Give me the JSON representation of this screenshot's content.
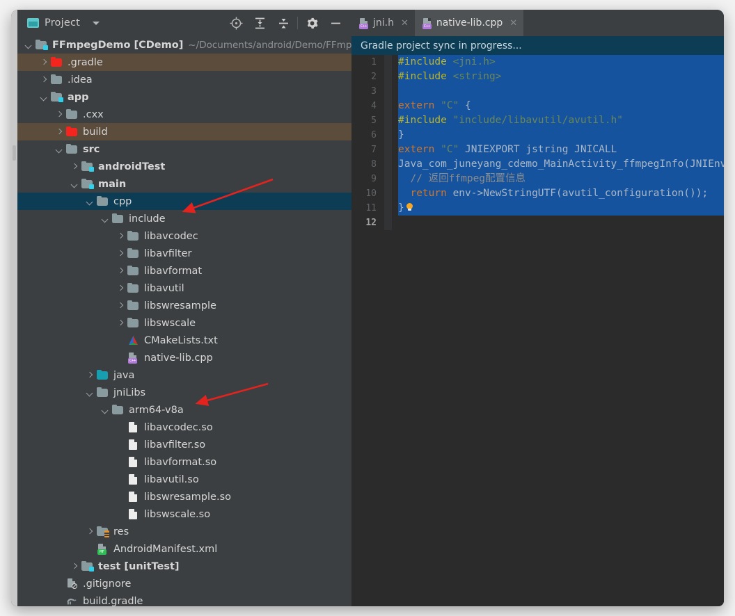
{
  "window": {
    "tool_window": {
      "title": "Project",
      "title_icon": "project-window-icon",
      "dropdown_icon": "chevron-down-icon",
      "toolbar_buttons": [
        {
          "name": "locate-icon",
          "label": "Select Opened File"
        },
        {
          "name": "expand-all-icon",
          "label": "Expand All"
        },
        {
          "name": "collapse-all-icon",
          "label": "Collapse All"
        },
        {
          "name": "gear-icon",
          "label": "Settings"
        },
        {
          "name": "minimize-icon",
          "label": "Hide"
        }
      ]
    }
  },
  "tree": [
    {
      "indent": 0,
      "arrow": "down",
      "icon": "module-folder",
      "label": "FFmpegDemo [CDemo]",
      "bold": true,
      "path": "~/Documents/android/Demo/FFmpeg",
      "highlight": "none"
    },
    {
      "indent": 1,
      "arrow": "right",
      "icon": "folder-red",
      "label": ".gradle",
      "bold": false,
      "highlight": "brown"
    },
    {
      "indent": 1,
      "arrow": "right",
      "icon": "folder",
      "label": ".idea",
      "bold": false,
      "highlight": "none"
    },
    {
      "indent": 1,
      "arrow": "down",
      "icon": "module-folder",
      "label": "app",
      "bold": true,
      "highlight": "none"
    },
    {
      "indent": 2,
      "arrow": "right",
      "icon": "folder",
      "label": ".cxx",
      "bold": false,
      "highlight": "none"
    },
    {
      "indent": 2,
      "arrow": "right",
      "icon": "folder-red",
      "label": "build",
      "bold": false,
      "highlight": "brown"
    },
    {
      "indent": 2,
      "arrow": "down",
      "icon": "folder",
      "label": "src",
      "bold": true,
      "highlight": "none"
    },
    {
      "indent": 3,
      "arrow": "right",
      "icon": "module-folder",
      "label": "androidTest",
      "bold": true,
      "highlight": "none"
    },
    {
      "indent": 3,
      "arrow": "down",
      "icon": "module-folder",
      "label": "main",
      "bold": true,
      "highlight": "none"
    },
    {
      "indent": 4,
      "arrow": "down",
      "icon": "folder",
      "label": "cpp",
      "bold": false,
      "highlight": "selected"
    },
    {
      "indent": 5,
      "arrow": "down",
      "icon": "folder",
      "label": "include",
      "bold": false,
      "highlight": "none"
    },
    {
      "indent": 6,
      "arrow": "right",
      "icon": "folder",
      "label": "libavcodec",
      "bold": false,
      "highlight": "none"
    },
    {
      "indent": 6,
      "arrow": "right",
      "icon": "folder",
      "label": "libavfilter",
      "bold": false,
      "highlight": "none"
    },
    {
      "indent": 6,
      "arrow": "right",
      "icon": "folder",
      "label": "libavformat",
      "bold": false,
      "highlight": "none"
    },
    {
      "indent": 6,
      "arrow": "right",
      "icon": "folder",
      "label": "libavutil",
      "bold": false,
      "highlight": "none"
    },
    {
      "indent": 6,
      "arrow": "right",
      "icon": "folder",
      "label": "libswresample",
      "bold": false,
      "highlight": "none"
    },
    {
      "indent": 6,
      "arrow": "right",
      "icon": "folder",
      "label": "libswscale",
      "bold": false,
      "highlight": "none"
    },
    {
      "indent": 6,
      "arrow": "none",
      "icon": "cmake-file",
      "label": "CMakeLists.txt",
      "bold": false,
      "highlight": "none"
    },
    {
      "indent": 6,
      "arrow": "none",
      "icon": "cpp-file",
      "label": "native-lib.cpp",
      "bold": false,
      "highlight": "none"
    },
    {
      "indent": 4,
      "arrow": "right",
      "icon": "folder-teal",
      "label": "java",
      "bold": false,
      "highlight": "none"
    },
    {
      "indent": 4,
      "arrow": "down",
      "icon": "folder",
      "label": "jniLibs",
      "bold": false,
      "highlight": "none"
    },
    {
      "indent": 5,
      "arrow": "down",
      "icon": "folder",
      "label": "arm64-v8a",
      "bold": false,
      "highlight": "none"
    },
    {
      "indent": 6,
      "arrow": "none",
      "icon": "file",
      "label": "libavcodec.so",
      "bold": false,
      "highlight": "none"
    },
    {
      "indent": 6,
      "arrow": "none",
      "icon": "file",
      "label": "libavfilter.so",
      "bold": false,
      "highlight": "none"
    },
    {
      "indent": 6,
      "arrow": "none",
      "icon": "file",
      "label": "libavformat.so",
      "bold": false,
      "highlight": "none"
    },
    {
      "indent": 6,
      "arrow": "none",
      "icon": "file",
      "label": "libavutil.so",
      "bold": false,
      "highlight": "none"
    },
    {
      "indent": 6,
      "arrow": "none",
      "icon": "file",
      "label": "libswresample.so",
      "bold": false,
      "highlight": "none"
    },
    {
      "indent": 6,
      "arrow": "none",
      "icon": "file",
      "label": "libswscale.so",
      "bold": false,
      "highlight": "none"
    },
    {
      "indent": 4,
      "arrow": "right",
      "icon": "res-folder",
      "label": "res",
      "bold": false,
      "highlight": "none"
    },
    {
      "indent": 4,
      "arrow": "none",
      "icon": "manifest-file",
      "label": "AndroidManifest.xml",
      "bold": false,
      "highlight": "none"
    },
    {
      "indent": 3,
      "arrow": "right",
      "icon": "module-folder",
      "label": "test [unitTest]",
      "bold": true,
      "highlight": "none"
    },
    {
      "indent": 2,
      "arrow": "none",
      "icon": "gitignore-file",
      "label": ".gitignore",
      "bold": false,
      "highlight": "none"
    },
    {
      "indent": 2,
      "arrow": "none",
      "icon": "gradle-file",
      "label": "build.gradle",
      "bold": false,
      "highlight": "none"
    }
  ],
  "editor": {
    "tabs": [
      {
        "label": "jni.h",
        "icon": "cpp-file-icon",
        "active": false,
        "close_icon": "close-icon"
      },
      {
        "label": "native-lib.cpp",
        "icon": "cpp-file-icon",
        "active": true,
        "close_icon": "close-icon"
      }
    ],
    "notification": "Gradle project sync in progress...",
    "lines": [
      {
        "n": "1",
        "selected": true,
        "tokens": [
          {
            "t": "#include ",
            "c": "pp"
          },
          {
            "t": "<jni.h>",
            "c": "s"
          }
        ]
      },
      {
        "n": "2",
        "selected": true,
        "tokens": [
          {
            "t": "#include ",
            "c": "pp"
          },
          {
            "t": "<string>",
            "c": "s"
          }
        ]
      },
      {
        "n": "3",
        "selected": true,
        "tokens": []
      },
      {
        "n": "4",
        "selected": true,
        "tokens": [
          {
            "t": "extern ",
            "c": "k"
          },
          {
            "t": "\"C\"",
            "c": "s"
          },
          {
            "t": " {",
            "c": "t"
          }
        ]
      },
      {
        "n": "5",
        "selected": true,
        "tokens": [
          {
            "t": "#include ",
            "c": "pp"
          },
          {
            "t": "\"include/libavutil/avutil.h\"",
            "c": "s"
          }
        ]
      },
      {
        "n": "6",
        "selected": true,
        "tokens": [
          {
            "t": "}",
            "c": "t"
          }
        ]
      },
      {
        "n": "7",
        "selected": true,
        "tokens": [
          {
            "t": "extern ",
            "c": "k"
          },
          {
            "t": "\"C\"",
            "c": "s"
          },
          {
            "t": " JNIEXPORT jstring JNICALL",
            "c": "t"
          }
        ]
      },
      {
        "n": "8",
        "selected": true,
        "tokens": [
          {
            "t": "Java_com_juneyang_cdemo_MainActivity_ffmpegInfo(JNIEnv",
            "c": "t"
          }
        ]
      },
      {
        "n": "9",
        "selected": true,
        "tokens": [
          {
            "t": "  // 返回ffmpeg配置信息",
            "c": "cm"
          }
        ]
      },
      {
        "n": "10",
        "selected": true,
        "tokens": [
          {
            "t": "  ",
            "c": "t"
          },
          {
            "t": "return ",
            "c": "k"
          },
          {
            "t": "env->NewStringUTF(avutil_configuration());",
            "c": "t"
          }
        ]
      },
      {
        "n": "11",
        "selected": true,
        "bulb": true,
        "tokens": [
          {
            "t": "}",
            "c": "t"
          }
        ]
      },
      {
        "n": "12",
        "selected": false,
        "current": true,
        "tokens": []
      }
    ]
  },
  "annotations": {
    "arrow_1": {
      "name": "red-arrow-to-include",
      "color": "#e4231f"
    },
    "arrow_2": {
      "name": "red-arrow-to-arm64",
      "color": "#e4231f"
    }
  },
  "colors": {
    "panel_bg": "#3c3f41",
    "editor_bg": "#2b2b2b",
    "selection": "#15539e",
    "sync_bar": "#0d3c55",
    "row_highlight": "#5b4c3c",
    "row_selected": "#0d3c55",
    "accent_red": "#e4231f"
  }
}
